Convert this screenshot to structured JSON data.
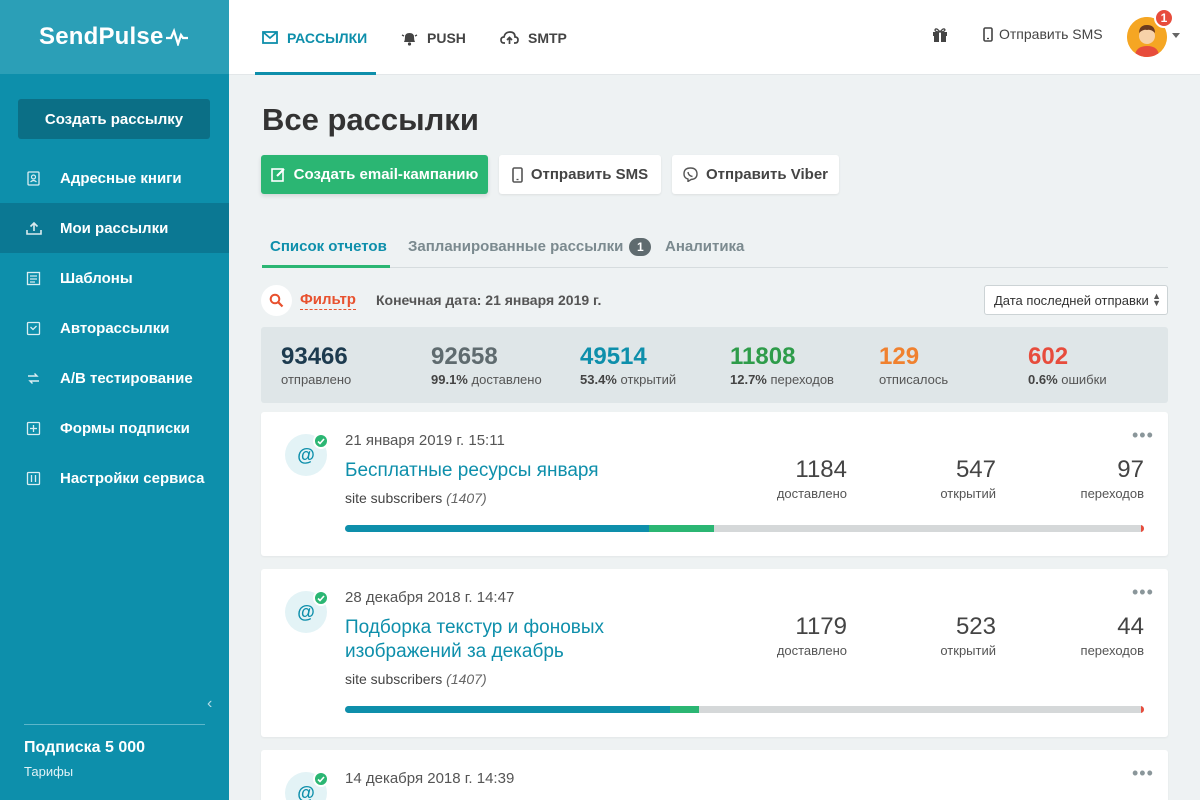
{
  "app": {
    "logo": "SendPulse"
  },
  "sidebar": {
    "create_button": "Создать рассылку",
    "items": [
      {
        "label": "Адресные книги",
        "icon": "address-book-icon",
        "active": false
      },
      {
        "label": "Мои рассылки",
        "icon": "upload-tray-icon",
        "active": true
      },
      {
        "label": "Шаблоны",
        "icon": "template-icon",
        "active": false
      },
      {
        "label": "Авторассылки",
        "icon": "autoresponder-icon",
        "active": false
      },
      {
        "label": "A/B тестирование",
        "icon": "ab-test-icon",
        "active": false
      },
      {
        "label": "Формы подписки",
        "icon": "form-icon",
        "active": false
      },
      {
        "label": "Настройки сервиса",
        "icon": "settings-sliders-icon",
        "active": false
      }
    ],
    "plan_name": "Подписка 5 000",
    "plan_link": "Тарифы"
  },
  "topbar": {
    "tabs": [
      {
        "label": "РАССЫЛКИ",
        "icon": "envelope-icon",
        "active": true
      },
      {
        "label": "PUSH",
        "icon": "bell-icon",
        "active": false
      },
      {
        "label": "SMTP",
        "icon": "cloud-upload-icon",
        "active": false
      }
    ],
    "sms_label": "Отправить SMS",
    "notification_count": "1"
  },
  "main": {
    "title": "Все рассылки",
    "actions": {
      "email": "Создать email-кампанию",
      "sms": "Отправить SMS",
      "viber": "Отправить Viber"
    },
    "subtabs": {
      "reports": "Список отчетов",
      "scheduled": "Запланированные рассылки",
      "scheduled_count": "1",
      "analytics": "Аналитика"
    },
    "filter": {
      "label": "Фильтр",
      "text": "Конечная дата: 21 января 2019 г.",
      "sort_value": "Дата последней отправки"
    },
    "stats": [
      {
        "value": "93466",
        "pct": "",
        "label": "отправлено",
        "color": "#1d3b4f"
      },
      {
        "value": "92658",
        "pct": "99.1%",
        "label": "доставлено",
        "color": "#5f6b6f"
      },
      {
        "value": "49514",
        "pct": "53.4%",
        "label": "открытий",
        "color": "#0e8fab"
      },
      {
        "value": "11808",
        "pct": "12.7%",
        "label": "переходов",
        "color": "#2e9c4a"
      },
      {
        "value": "129",
        "pct": "",
        "label": "отписалось",
        "color": "#f0812f"
      },
      {
        "value": "602",
        "pct": "0.6%",
        "label": "ошибки",
        "color": "#e74c3c"
      }
    ],
    "campaigns": [
      {
        "date": "21 января 2019 г. 15:11",
        "title": "Бесплатные ресурсы января",
        "list": "site subscribers",
        "list_count": "(1407)",
        "delivered": "1184",
        "delivered_label": "доставлено",
        "opens": "547",
        "opens_label": "открытий",
        "clicks": "97",
        "clicks_label": "переходов",
        "progress": {
          "opens": 0.38,
          "clicks": 0.082
        }
      },
      {
        "date": "28 декабря 2018 г. 14:47",
        "title": "Подборка текстур и фоновых изображений за декабрь",
        "list": "site subscribers",
        "list_count": "(1407)",
        "delivered": "1179",
        "delivered_label": "доставлено",
        "opens": "523",
        "opens_label": "открытий",
        "clicks": "44",
        "clicks_label": "переходов",
        "progress": {
          "opens": 0.407,
          "clicks": 0.036
        }
      },
      {
        "date": "14 декабря 2018 г. 14:39"
      }
    ]
  }
}
